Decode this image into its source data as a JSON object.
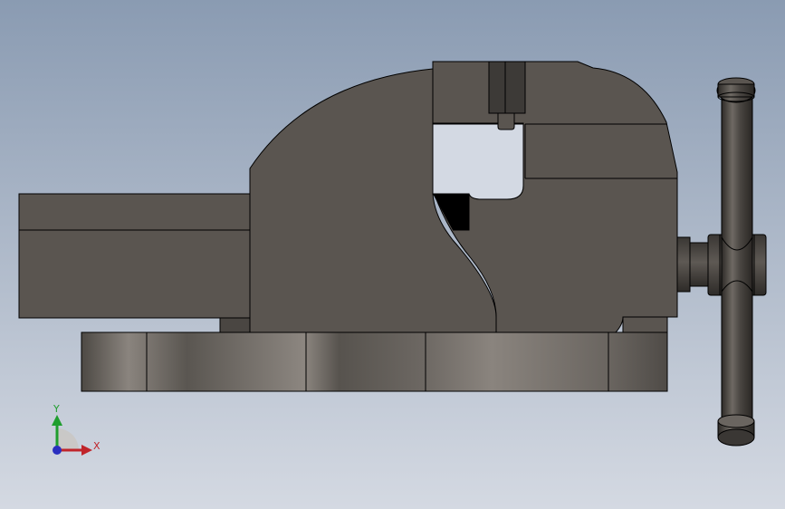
{
  "view": {
    "background_top": "#8a9bb2",
    "background_bottom": "#d4d9e2"
  },
  "model": {
    "name": "bench-vise",
    "colors": {
      "body": "#5a5550",
      "body_dark": "#3d3a37",
      "edge": "#000000",
      "base_light": "#8e8882",
      "base_dark": "#4f4b47"
    }
  },
  "triad": {
    "x_label": "X",
    "y_label": "Y",
    "x_color": "#c0242a",
    "y_color": "#1f9e2e",
    "z_color": "#2a2fbf"
  }
}
